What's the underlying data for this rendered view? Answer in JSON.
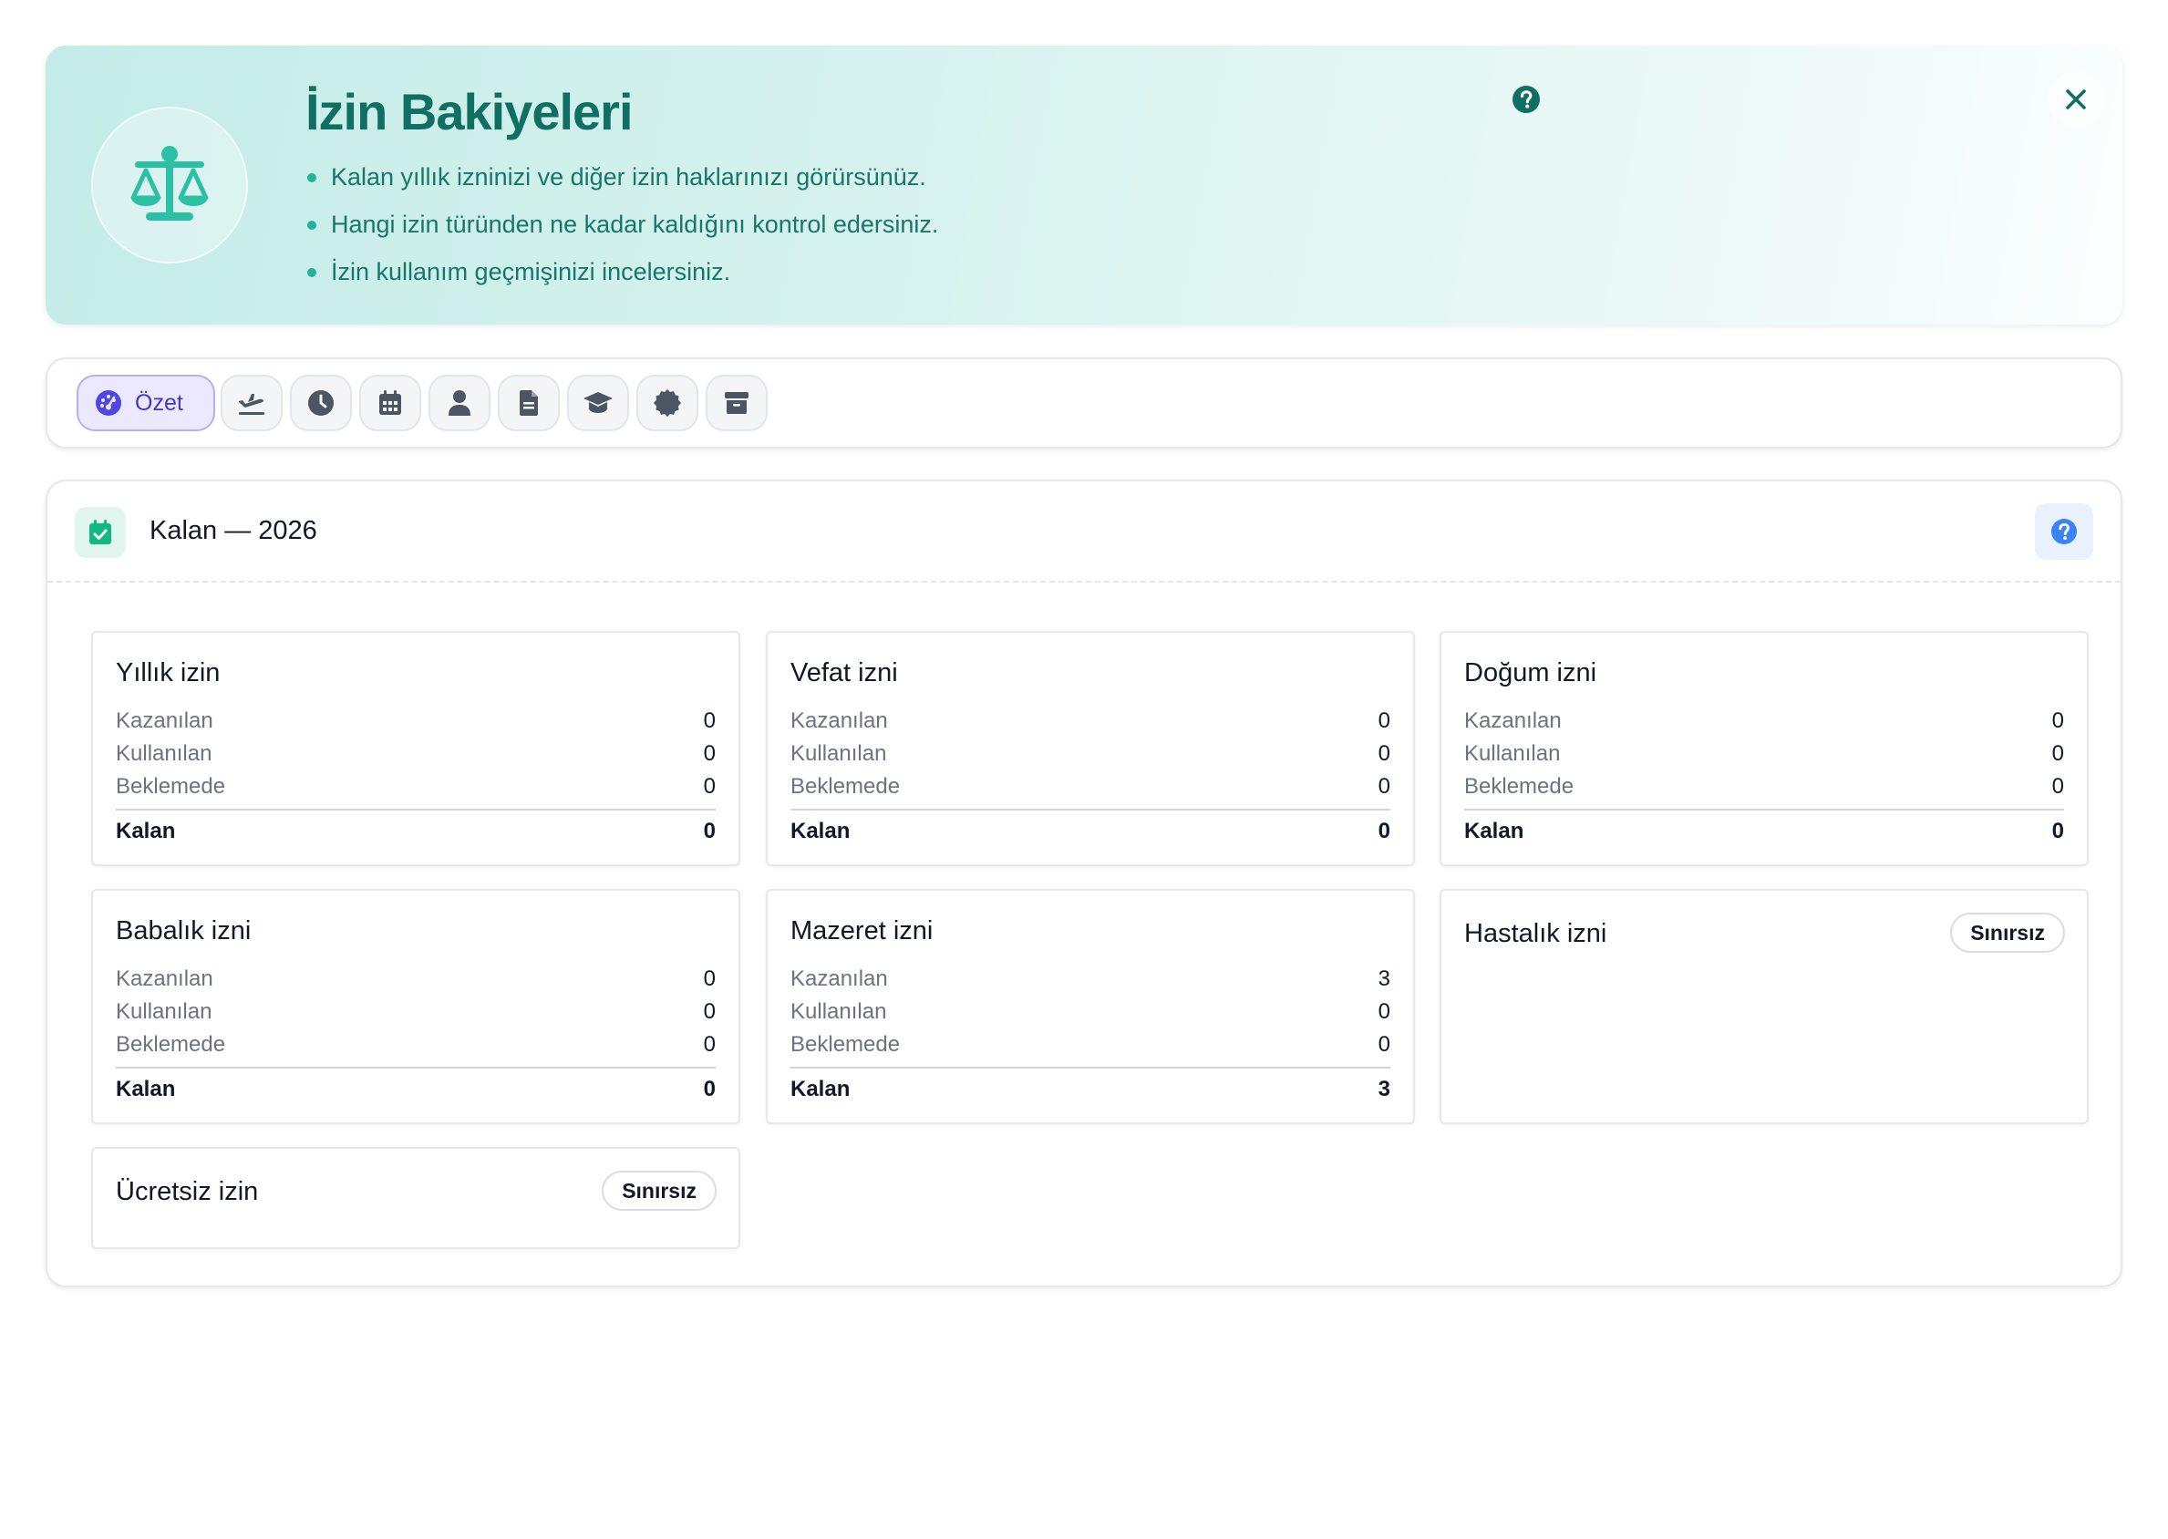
{
  "hero": {
    "title": "İzin Bakiyeleri",
    "bullets": [
      "Kalan yıllık izninizi ve diğer izin haklarınızı görürsünüz.",
      "Hangi izin türünden ne kadar kaldığını kontrol edersiniz.",
      "İzin kullanım geçmişinizi incelersiniz."
    ],
    "icon": "balance-scale-icon",
    "help_icon": "question-circle-icon",
    "close_icon": "close-icon"
  },
  "toolbar": {
    "tabs": [
      {
        "label": "Özet",
        "icon": "dashboard-gauge-icon",
        "active": true
      },
      {
        "label": "",
        "icon": "plane-departure-icon"
      },
      {
        "label": "",
        "icon": "clock-icon"
      },
      {
        "label": "",
        "icon": "calendar-icon"
      },
      {
        "label": "",
        "icon": "user-icon"
      },
      {
        "label": "",
        "icon": "document-icon"
      },
      {
        "label": "",
        "icon": "graduation-cap-icon"
      },
      {
        "label": "",
        "icon": "gear-badge-icon"
      },
      {
        "label": "",
        "icon": "archive-box-icon"
      }
    ]
  },
  "panel": {
    "title": "Kalan — 2026",
    "header_icon": "calendar-check-icon",
    "help_icon": "question-circle-icon"
  },
  "row_labels": {
    "earned": "Kazanılan",
    "used": "Kullanılan",
    "pending": "Beklemede",
    "remaining": "Kalan"
  },
  "cards": [
    {
      "title": "Yıllık izin",
      "earned": "0",
      "used": "0",
      "pending": "0",
      "remaining": "0"
    },
    {
      "title": "Vefat izni",
      "earned": "0",
      "used": "0",
      "pending": "0",
      "remaining": "0"
    },
    {
      "title": "Doğum izni",
      "earned": "0",
      "used": "0",
      "pending": "0",
      "remaining": "0"
    },
    {
      "title": "Babalık izni",
      "earned": "0",
      "used": "0",
      "pending": "0",
      "remaining": "0"
    },
    {
      "title": "Mazeret izni",
      "earned": "3",
      "used": "0",
      "pending": "0",
      "remaining": "3"
    },
    {
      "title": "Hastalık izni",
      "badge": "Sınırsız"
    },
    {
      "title": "Ücretsiz izin",
      "badge": "Sınırsız"
    }
  ],
  "colors": {
    "brand_teal": "#0f6f63",
    "accent_teal": "#22b39a",
    "active_tab_bg": "#ece8ff",
    "active_tab_text": "#4338ca",
    "icon_gray": "#4b5563",
    "help_blue": "#3b82f6"
  }
}
